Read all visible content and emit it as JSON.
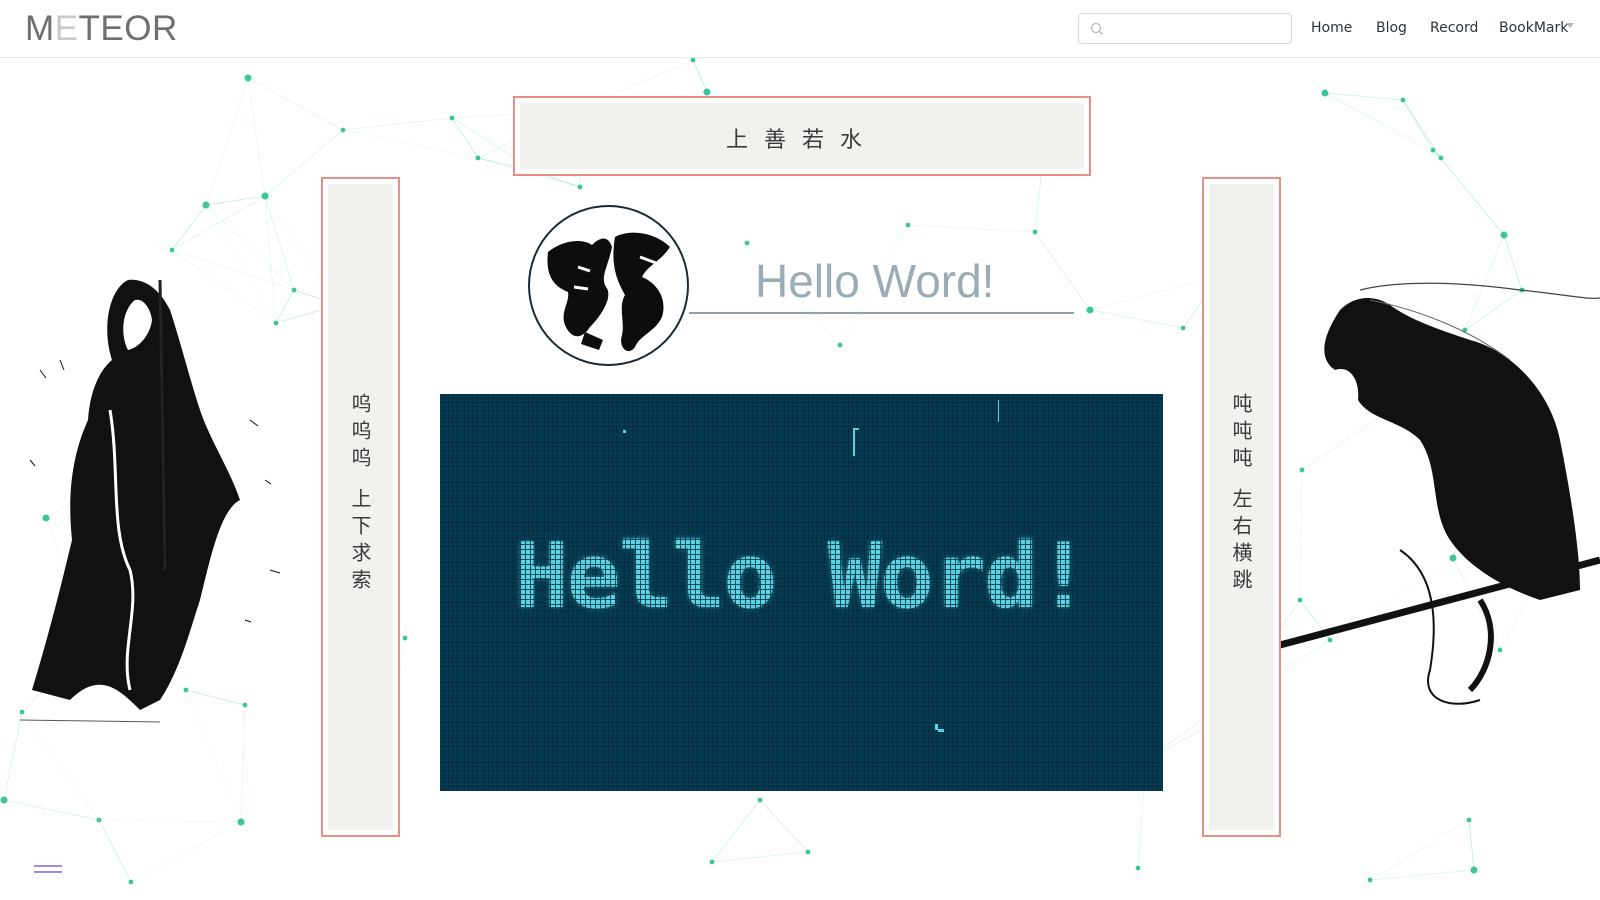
{
  "header": {
    "logo": {
      "part1": "M",
      "part2": "E",
      "part3": "TEOR"
    },
    "search": {
      "value": "",
      "placeholder": ""
    },
    "nav": [
      {
        "label": "Home"
      },
      {
        "label": "Blog"
      },
      {
        "label": "Record"
      },
      {
        "label": "BookMark"
      }
    ]
  },
  "scrolls": {
    "top": "上善若水",
    "left": [
      "呜呜呜",
      "上下求索"
    ],
    "right": [
      "吨吨吨",
      "左右横跳"
    ]
  },
  "title": {
    "hello": "Hello Word!"
  },
  "panel": {
    "text": "Hello Word!"
  },
  "colors": {
    "accent_border": "#ea8f88",
    "panel_bg": "#053a51",
    "panel_text": "#5fd2e0",
    "network": "#7fd6b6",
    "menu": "#a98bdc"
  },
  "icons": [
    "search-icon",
    "chevron-down-icon",
    "menu-icon"
  ]
}
